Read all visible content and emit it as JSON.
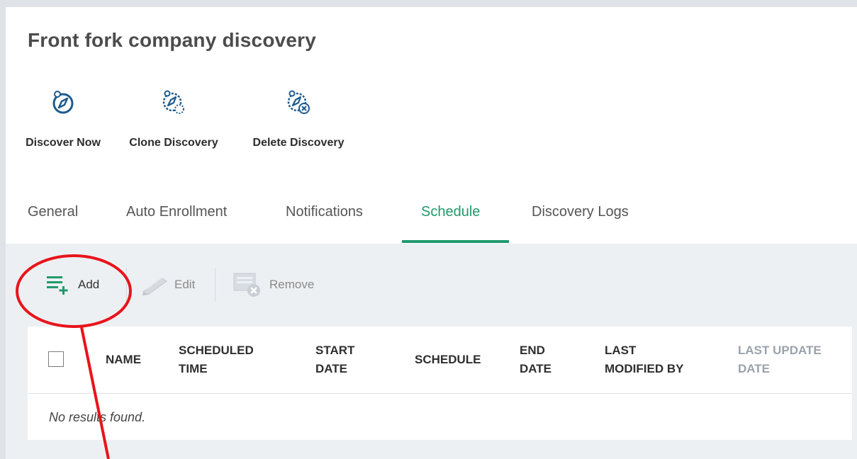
{
  "page": {
    "title": "Front fork company discovery"
  },
  "actions": [
    {
      "label": "Discover Now",
      "icon": "discover-now-icon"
    },
    {
      "label": "Clone Discovery",
      "icon": "clone-discovery-icon"
    },
    {
      "label": "Delete Discovery",
      "icon": "delete-discovery-icon"
    }
  ],
  "tabs": [
    {
      "label": "General"
    },
    {
      "label": "Auto Enrollment"
    },
    {
      "label": "Notifications"
    },
    {
      "label": "Schedule",
      "active": true
    },
    {
      "label": "Discovery Logs"
    }
  ],
  "toolbar": {
    "add_label": "Add",
    "edit_label": "Edit",
    "remove_label": "Remove"
  },
  "table": {
    "columns": [
      {
        "line1": "NAME",
        "line2": ""
      },
      {
        "line1": "SCHEDULED",
        "line2": "TIME"
      },
      {
        "line1": "START",
        "line2": "DATE"
      },
      {
        "line1": "SCHEDULE",
        "line2": ""
      },
      {
        "line1": "END",
        "line2": "DATE"
      },
      {
        "line1": "LAST",
        "line2": "MODIFIED BY"
      },
      {
        "line1": "LAST UPDATE",
        "line2": "DATE"
      }
    ],
    "empty_text": "No results found."
  },
  "colors": {
    "accent": "#1f9a6c",
    "annotation": "#e8141b"
  }
}
